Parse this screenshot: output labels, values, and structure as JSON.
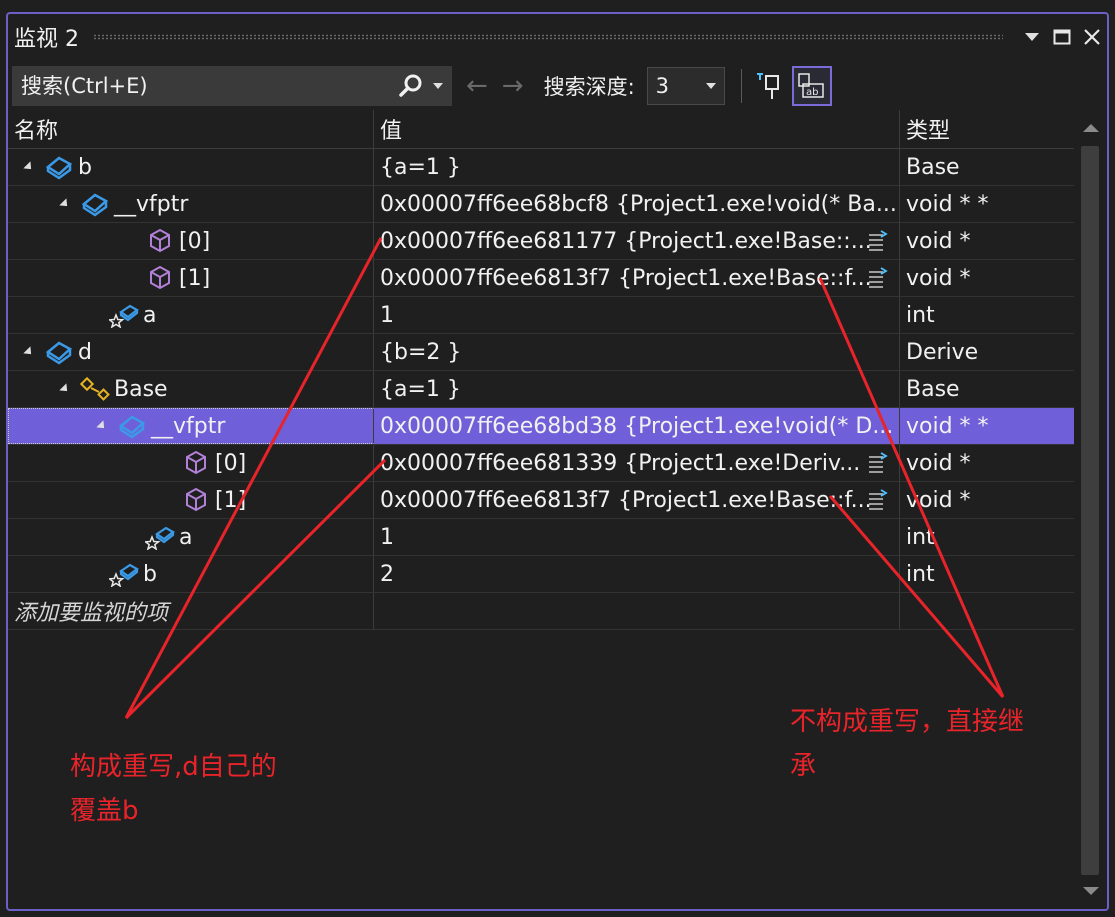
{
  "title": "监视 2",
  "search": {
    "placeholder": "搜索(Ctrl+E)"
  },
  "toolbar": {
    "depth_label": "搜索深度:",
    "depth_value": "3"
  },
  "columns": {
    "name": "名称",
    "value": "值",
    "type": "类型"
  },
  "rows": [
    {
      "name": "b",
      "value": "{a=1 }",
      "type": "Base"
    },
    {
      "name": "__vfptr",
      "value": "0x00007ff6ee68bcf8 {Project1.exe!void(* Ba...",
      "type": "void * *"
    },
    {
      "name": "[0]",
      "value": "0x00007ff6ee681177 {Project1.exe!Base::...",
      "type": "void *"
    },
    {
      "name": "[1]",
      "value": "0x00007ff6ee6813f7 {Project1.exe!Base::f...",
      "type": "void *"
    },
    {
      "name": "a",
      "value": "1",
      "type": "int"
    },
    {
      "name": "d",
      "value": "{b=2 }",
      "type": "Derive"
    },
    {
      "name": "Base",
      "value": "{a=1 }",
      "type": "Base"
    },
    {
      "name": "__vfptr",
      "value": "0x00007ff6ee68bd38 {Project1.exe!void(* D...",
      "type": "void * *"
    },
    {
      "name": "[0]",
      "value": "0x00007ff6ee681339 {Project1.exe!Deriv...",
      "type": "void *"
    },
    {
      "name": "[1]",
      "value": "0x00007ff6ee6813f7 {Project1.exe!Base::f...",
      "type": "void *"
    },
    {
      "name": "a",
      "value": "1",
      "type": "int"
    },
    {
      "name": "b",
      "value": "2",
      "type": "int"
    }
  ],
  "add_item": "添加要监视的项",
  "annotations": {
    "left_line1": "构成重写,d自己的",
    "left_line2": "覆盖b",
    "right_line1": "不构成重写，直接继",
    "right_line2": "承"
  },
  "colors": {
    "accent": "#6f5fd8",
    "annotation": "#e8242a",
    "object_icon": "#3b9ae8",
    "pointer_icon": "#b180d7"
  }
}
